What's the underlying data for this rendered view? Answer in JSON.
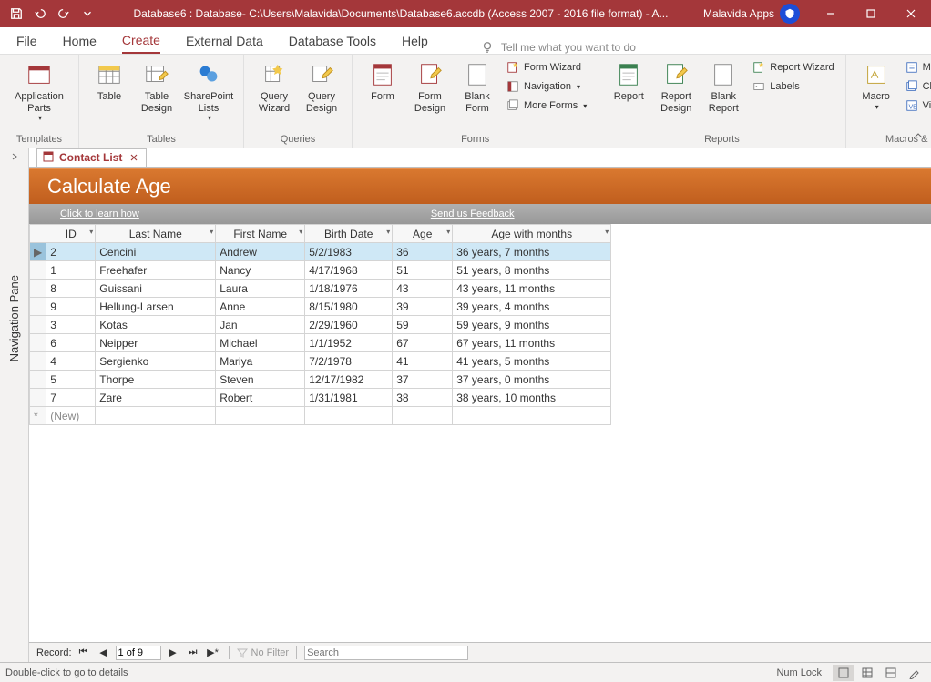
{
  "window": {
    "title": "Database6 : Database- C:\\Users\\Malavida\\Documents\\Database6.accdb (Access 2007 - 2016 file format) - A...",
    "brand": "Malavida Apps"
  },
  "menu": {
    "file": "File",
    "home": "Home",
    "create": "Create",
    "external": "External Data",
    "dbtools": "Database Tools",
    "help": "Help",
    "search_placeholder": "Tell me what you want to do"
  },
  "ribbon": {
    "templates": {
      "label": "Templates",
      "app_parts": "Application\nParts"
    },
    "tables": {
      "label": "Tables",
      "table": "Table",
      "table_design": "Table\nDesign",
      "sp_lists": "SharePoint\nLists"
    },
    "queries": {
      "label": "Queries",
      "wizard": "Query\nWizard",
      "design": "Query\nDesign"
    },
    "forms": {
      "label": "Forms",
      "form": "Form",
      "form_design": "Form\nDesign",
      "blank": "Blank\nForm",
      "form_wizard": "Form Wizard",
      "navigation": "Navigation",
      "more": "More Forms"
    },
    "reports": {
      "label": "Reports",
      "report": "Report",
      "report_design": "Report\nDesign",
      "blank": "Blank\nReport",
      "report_wizard": "Report Wizard",
      "labels": "Labels"
    },
    "macros": {
      "label": "Macros & Code",
      "macro": "Macro",
      "module": "Module",
      "class_module": "Class Module",
      "vb": "Visual Basic"
    }
  },
  "nav_pane": "Navigation Pane",
  "tab": {
    "name": "Contact List"
  },
  "form": {
    "title": "Calculate Age",
    "learn": "Click to learn how",
    "feedback": "Send us Feedback"
  },
  "columns": {
    "id": "ID",
    "last": "Last Name",
    "first": "First Name",
    "birth": "Birth Date",
    "age": "Age",
    "agem": "Age with months"
  },
  "rows": [
    {
      "id": "2",
      "last": "Cencini",
      "first": "Andrew",
      "birth": "5/2/1983",
      "age": "36",
      "agem": "36 years, 7 months",
      "selected": true
    },
    {
      "id": "1",
      "last": "Freehafer",
      "first": "Nancy",
      "birth": "4/17/1968",
      "age": "51",
      "agem": "51 years, 8 months"
    },
    {
      "id": "8",
      "last": "Guissani",
      "first": "Laura",
      "birth": "1/18/1976",
      "age": "43",
      "agem": "43 years, 11 months"
    },
    {
      "id": "9",
      "last": "Hellung-Larsen",
      "first": "Anne",
      "birth": "8/15/1980",
      "age": "39",
      "agem": "39 years, 4 months"
    },
    {
      "id": "3",
      "last": "Kotas",
      "first": "Jan",
      "birth": "2/29/1960",
      "age": "59",
      "agem": "59 years, 9 months"
    },
    {
      "id": "6",
      "last": "Neipper",
      "first": "Michael",
      "birth": "1/1/1952",
      "age": "67",
      "agem": "67 years, 11 months"
    },
    {
      "id": "4",
      "last": "Sergienko",
      "first": "Mariya",
      "birth": "7/2/1978",
      "age": "41",
      "agem": "41 years, 5 months"
    },
    {
      "id": "5",
      "last": "Thorpe",
      "first": "Steven",
      "birth": "12/17/1982",
      "age": "37",
      "agem": "37 years, 0 months"
    },
    {
      "id": "7",
      "last": "Zare",
      "first": "Robert",
      "birth": "1/31/1981",
      "age": "38",
      "agem": "38 years, 10 months"
    }
  ],
  "newrow": "(New)",
  "recnav": {
    "label": "Record:",
    "pos": "1 of 9",
    "nofilter": "No Filter",
    "search": "Search"
  },
  "status": {
    "msg": "Double-click to go to details",
    "numlock": "Num Lock"
  }
}
